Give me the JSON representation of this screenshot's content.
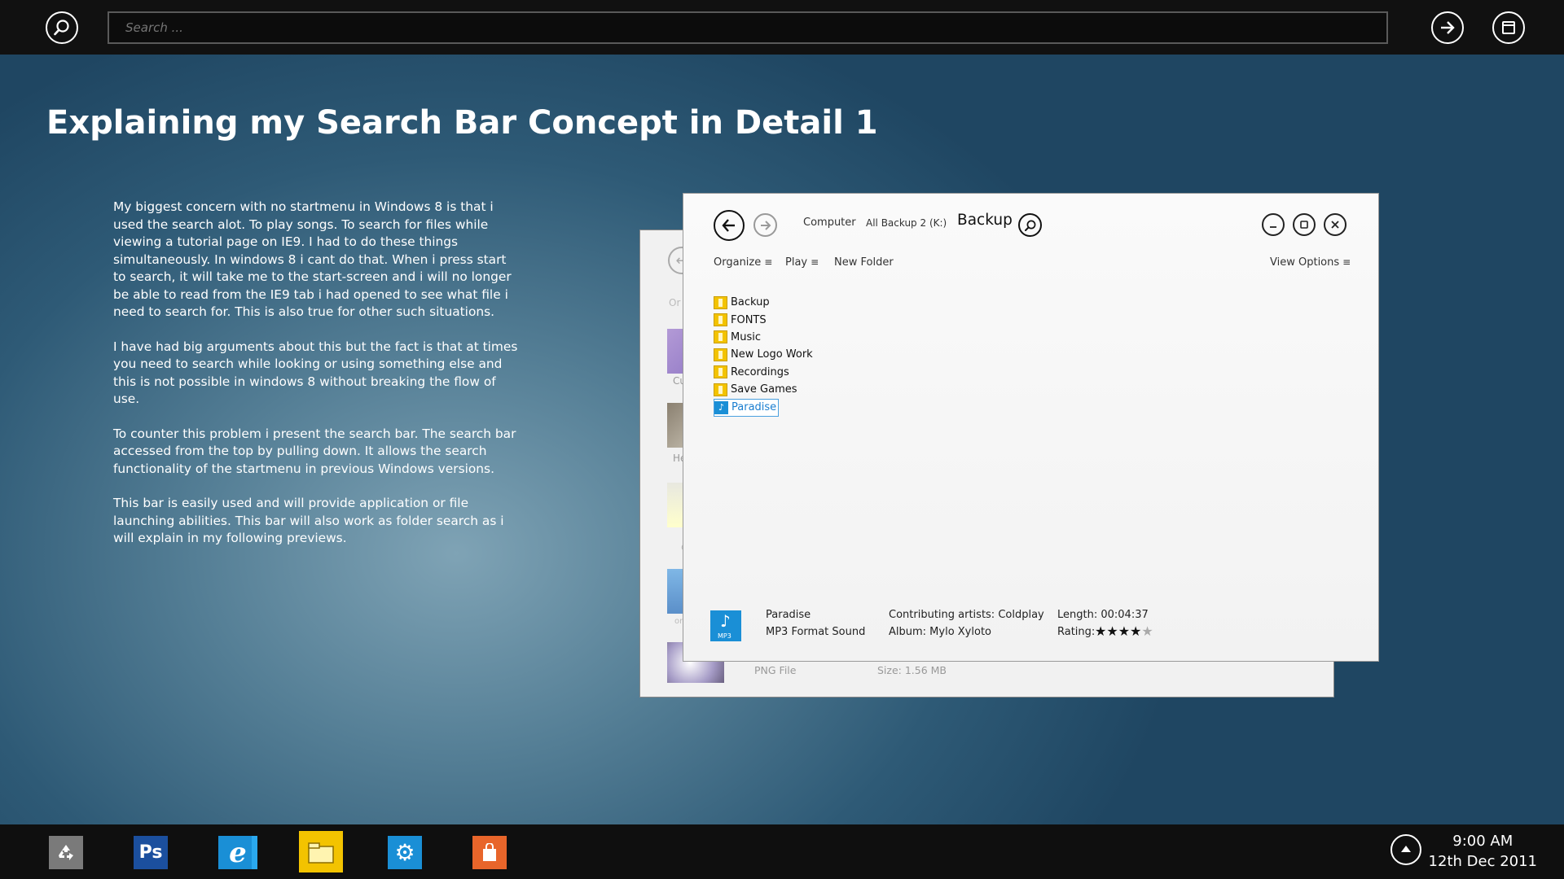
{
  "topbar": {
    "search_placeholder": "Search ...",
    "icons": [
      "search-icon",
      "arrow-right-icon",
      "window-icon"
    ]
  },
  "page": {
    "title": "Explaining my Search Bar Concept in Detail 1",
    "paragraphs": [
      "My biggest concern with no startmenu in Windows 8 is that i used the search alot. To play songs. To search for files while viewing a tutorial page on IE9. I had to do these things simultaneously. In windows 8 i cant do that. When i press start to search, it will take me to the start-screen and i will no longer be able to read from the IE9 tab i had opened to see what file i need to search for. This is also true for other such situations.",
      "I have had big arguments about this but the fact is that at times you need to search while looking or using something else and this is not possible in windows 8 without breaking the flow of use.",
      "To counter this problem i present the search bar. The search bar accessed from the top by pulling down. It allows the search functionality of the startmenu in previous Windows versions.",
      "This bar is easily used and will provide application or file launching abilities. This bar will also work as folder search as i will explain in my following previews."
    ]
  },
  "back_window": {
    "partial_labels": [
      "Or",
      "Cu",
      "He",
      "c",
      "or"
    ],
    "footer_type": "PNG File",
    "footer_size": "Size: 1.56 MB"
  },
  "explorer": {
    "breadcrumb": [
      "Computer",
      "All Backup 2 (K:)"
    ],
    "current_folder": "Backup",
    "toolbar": {
      "organize": "Organize",
      "play": "Play",
      "new_folder": "New Folder",
      "view_options": "View Options"
    },
    "files": [
      {
        "name": "Backup",
        "type": "folder"
      },
      {
        "name": "FONTS",
        "type": "folder"
      },
      {
        "name": "Music",
        "type": "folder"
      },
      {
        "name": "New Logo Work",
        "type": "folder"
      },
      {
        "name": "Recordings",
        "type": "folder"
      },
      {
        "name": "Save Games",
        "type": "folder"
      },
      {
        "name": "Paradise",
        "type": "music",
        "selected": true
      }
    ],
    "details": {
      "badge_label": "MP3",
      "name": "Paradise",
      "format": "MP3 Format Sound",
      "artists": "Contributing artists: Coldplay",
      "album": "Album: Mylo Xyloto",
      "length": "Length: 00:04:37",
      "rating_label": "Rating:",
      "rating": 4,
      "rating_max": 5
    }
  },
  "taskbar": {
    "apps": [
      {
        "name": "recycle-bin",
        "color": "#7a7a7a"
      },
      {
        "name": "photoshop",
        "label": "Ps",
        "color": "#1b4f9e"
      },
      {
        "name": "internet-explorer",
        "color": "#1a8fd6"
      },
      {
        "name": "file-explorer",
        "color": "#f3c300"
      },
      {
        "name": "settings",
        "color": "#1a8fd6"
      },
      {
        "name": "store",
        "color": "#e8652a"
      }
    ],
    "time": "9:00 AM",
    "date": "12th Dec 2011"
  }
}
